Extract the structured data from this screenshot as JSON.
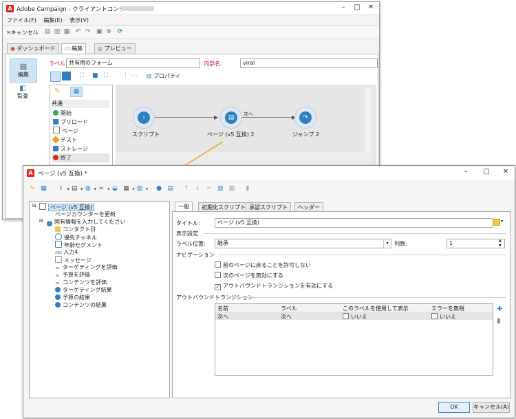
{
  "back_window": {
    "title": "Adobe Campaign - クライアントコンソール",
    "menu": [
      "ファイル(F)",
      "編集(E)",
      "表示(V)"
    ],
    "toolbar": {
      "cancel_label": "キャンセル"
    },
    "tabs": [
      "ダッシュボード",
      "編集",
      "プレビュー"
    ],
    "side_nav": [
      "編集",
      "監査"
    ],
    "label_field": {
      "label": "ラベル:",
      "value": "共有用のフォーム"
    },
    "internal_name": {
      "label": "内部名:",
      "value": "viral"
    },
    "properties_label": "プロパティ",
    "palette": {
      "section": "共通",
      "items": [
        "開始",
        "プリロード",
        "ページ",
        "テスト",
        "ストレージ",
        "終了"
      ]
    },
    "workflow": {
      "nodes": [
        "スクリプト",
        "ページ (v5 互換) 2",
        "ジャンプ 2"
      ],
      "transition_label": "次へ"
    }
  },
  "dialog": {
    "title": "ページ (v5 互換) *",
    "tree": {
      "root": "ページ (v5 互換)",
      "children": [
        {
          "label": "ページカウンターを更新",
          "icon": "none"
        },
        {
          "label": "固有情報を入力してください",
          "icon": "question"
        },
        {
          "label": "コンタクト日",
          "icon": "calendar"
        },
        {
          "label": "優先チャネル",
          "icon": "radio"
        },
        {
          "label": "年齢セグメント",
          "icon": "list"
        },
        {
          "label": "入力4",
          "icon": "abc"
        },
        {
          "label": "メッセージ",
          "icon": "text"
        },
        {
          "label": "ターゲティングを評価",
          "icon": "link"
        },
        {
          "label": "予算を評価",
          "icon": "link"
        },
        {
          "label": "コンテンツを評価",
          "icon": "link"
        },
        {
          "label": "ターゲティング結果",
          "icon": "globe"
        },
        {
          "label": "予算の結果",
          "icon": "globe"
        },
        {
          "label": "コンテンツの結果",
          "icon": "globe"
        }
      ]
    },
    "tabs": [
      "一般",
      "初期化スクリプト",
      "承認スクリプト",
      "ヘッダー"
    ],
    "title_field": {
      "label": "タイトル:",
      "value": "ページ (v5 互換)"
    },
    "display_section": "表示設定",
    "label_position": {
      "label": "ラベル位置:",
      "value": "継承"
    },
    "columns": {
      "label": "列数:",
      "value": "1"
    },
    "navigation_section": "ナビゲーション",
    "checkboxes": [
      {
        "label": "前のページに戻ることを許可しない",
        "checked": false
      },
      {
        "label": "次のページを無効にする",
        "checked": false
      },
      {
        "label": "アウトバウンドトランジションを有効にする",
        "checked": true
      }
    ],
    "outbound_section": "アウトバウンドトランジション",
    "table": {
      "headers": [
        "名前",
        "ラベル",
        "このラベルを使用して表示",
        "エラーを無視"
      ],
      "rows": [
        [
          "次へ",
          "次へ",
          "いいえ",
          "いいえ"
        ]
      ]
    },
    "ok_label": "OK",
    "cancel_label": "キャンセル(A)"
  },
  "colors": {
    "accent": "#2e7fc4",
    "arrow": "#f39c21",
    "brand": "#e1251b"
  }
}
